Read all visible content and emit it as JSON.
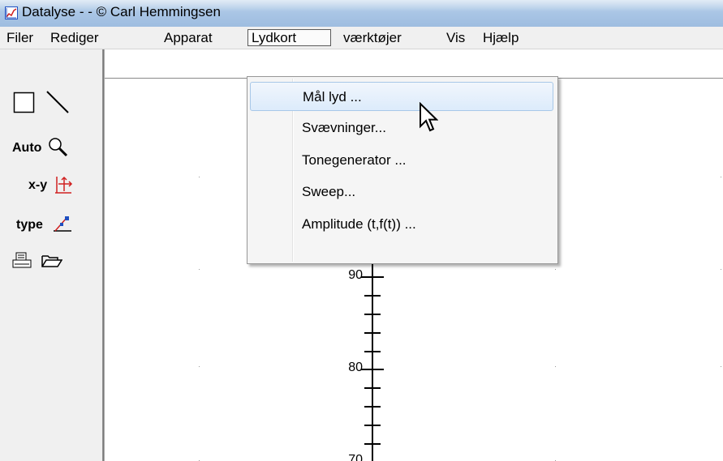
{
  "window": {
    "title": "Datalyse -  - © Carl Hemmingsen"
  },
  "menubar": {
    "items": [
      {
        "label": "Filer"
      },
      {
        "label": "Rediger"
      },
      {
        "label": "Apparat"
      },
      {
        "label": "Lydkort",
        "open": true
      },
      {
        "label": "værktøjer"
      },
      {
        "label": "Vis"
      },
      {
        "label": "Hjælp"
      }
    ]
  },
  "toolbar": {
    "auto_label": "Auto",
    "xy_label": "x-y",
    "type_label": "type",
    "icons": [
      "rectangle-icon",
      "line-icon",
      "zoom-icon",
      "xy-axes-icon",
      "graph-type-icon",
      "print-icon",
      "open-folder-icon"
    ]
  },
  "lydkort_menu": {
    "items": [
      {
        "label": "Mål lyd ...",
        "highlighted": true
      },
      {
        "label": "Svævninger..."
      },
      {
        "label": "Tonegenerator ..."
      },
      {
        "label": "Sweep..."
      },
      {
        "label": "Amplitude (t,f(t)) ..."
      }
    ]
  },
  "plot": {
    "y_axis_labels": [
      "90",
      "80",
      "70"
    ]
  },
  "colors": {
    "titlebar": "#a9c5e5",
    "menu_highlight": "#dcebfb",
    "chrome": "#f0f0f0",
    "accent_red": "#d02020",
    "accent_blue": "#2050c0"
  }
}
